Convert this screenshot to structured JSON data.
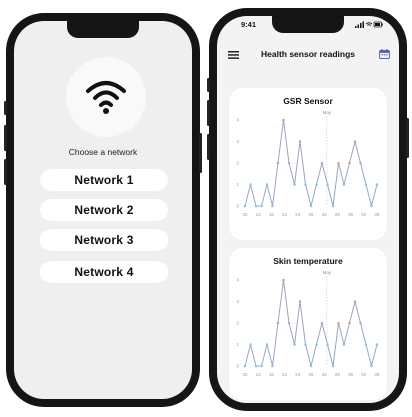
{
  "network_screen": {
    "prompt": "Choose a network",
    "networks": [
      "Network 1",
      "Network 2",
      "Network 3",
      "Network 4"
    ],
    "icon": "wifi-icon"
  },
  "sensor_screen": {
    "status_time": "9:41",
    "title": "Health sensor readings",
    "charts": [
      {
        "title": "GSR Sensor",
        "month_label": "May",
        "y_ticks": [
          "4",
          "3",
          "2",
          "1",
          "0"
        ],
        "x_ticks": [
          "02",
          "12",
          "16",
          "21",
          "24",
          "25",
          "26",
          "28",
          "30",
          "02",
          "05"
        ]
      },
      {
        "title": "Skin temperature",
        "month_label": "May",
        "y_ticks": [
          "4",
          "3",
          "2",
          "1",
          "0"
        ],
        "x_ticks": [
          "02",
          "12",
          "16",
          "21",
          "24",
          "25",
          "26",
          "28",
          "30",
          "02",
          "05"
        ]
      }
    ]
  },
  "chart_data": [
    {
      "type": "line",
      "title": "GSR Sensor",
      "ylim": [
        0,
        4
      ],
      "values": [
        0,
        1,
        0,
        0,
        1,
        0,
        2,
        4,
        2,
        1,
        3,
        1,
        0,
        1,
        2,
        1,
        0,
        2,
        1,
        2,
        3,
        2,
        1,
        0,
        1
      ],
      "color": "#9da3c9",
      "marker_colors": [
        "#e29aa9",
        "#7fd3cf"
      ]
    },
    {
      "type": "line",
      "title": "Skin temperature",
      "ylim": [
        0,
        4
      ],
      "values": [
        0,
        1,
        0,
        0,
        1,
        0,
        2,
        4,
        2,
        1,
        3,
        1,
        0,
        1,
        2,
        1,
        0,
        2,
        1,
        2,
        3,
        2,
        1,
        0,
        1
      ],
      "color": "#9da3c9",
      "marker_colors": [
        "#e29aa9",
        "#7fd3cf"
      ]
    }
  ]
}
